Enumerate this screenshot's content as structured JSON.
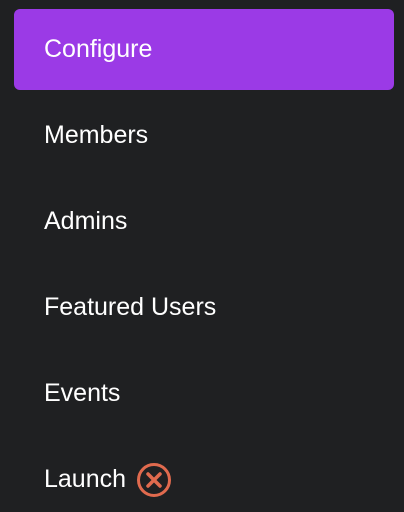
{
  "sidebar": {
    "accent_color": "#9b3ae6",
    "background_color": "#1f2022",
    "active_index": 0,
    "items": [
      {
        "label": "Configure"
      },
      {
        "label": "Members"
      },
      {
        "label": "Admins"
      },
      {
        "label": "Featured Users"
      },
      {
        "label": "Events"
      },
      {
        "label": "Launch",
        "status_icon": "error-x-circle-icon",
        "status_color": "#e06a4e"
      }
    ]
  }
}
